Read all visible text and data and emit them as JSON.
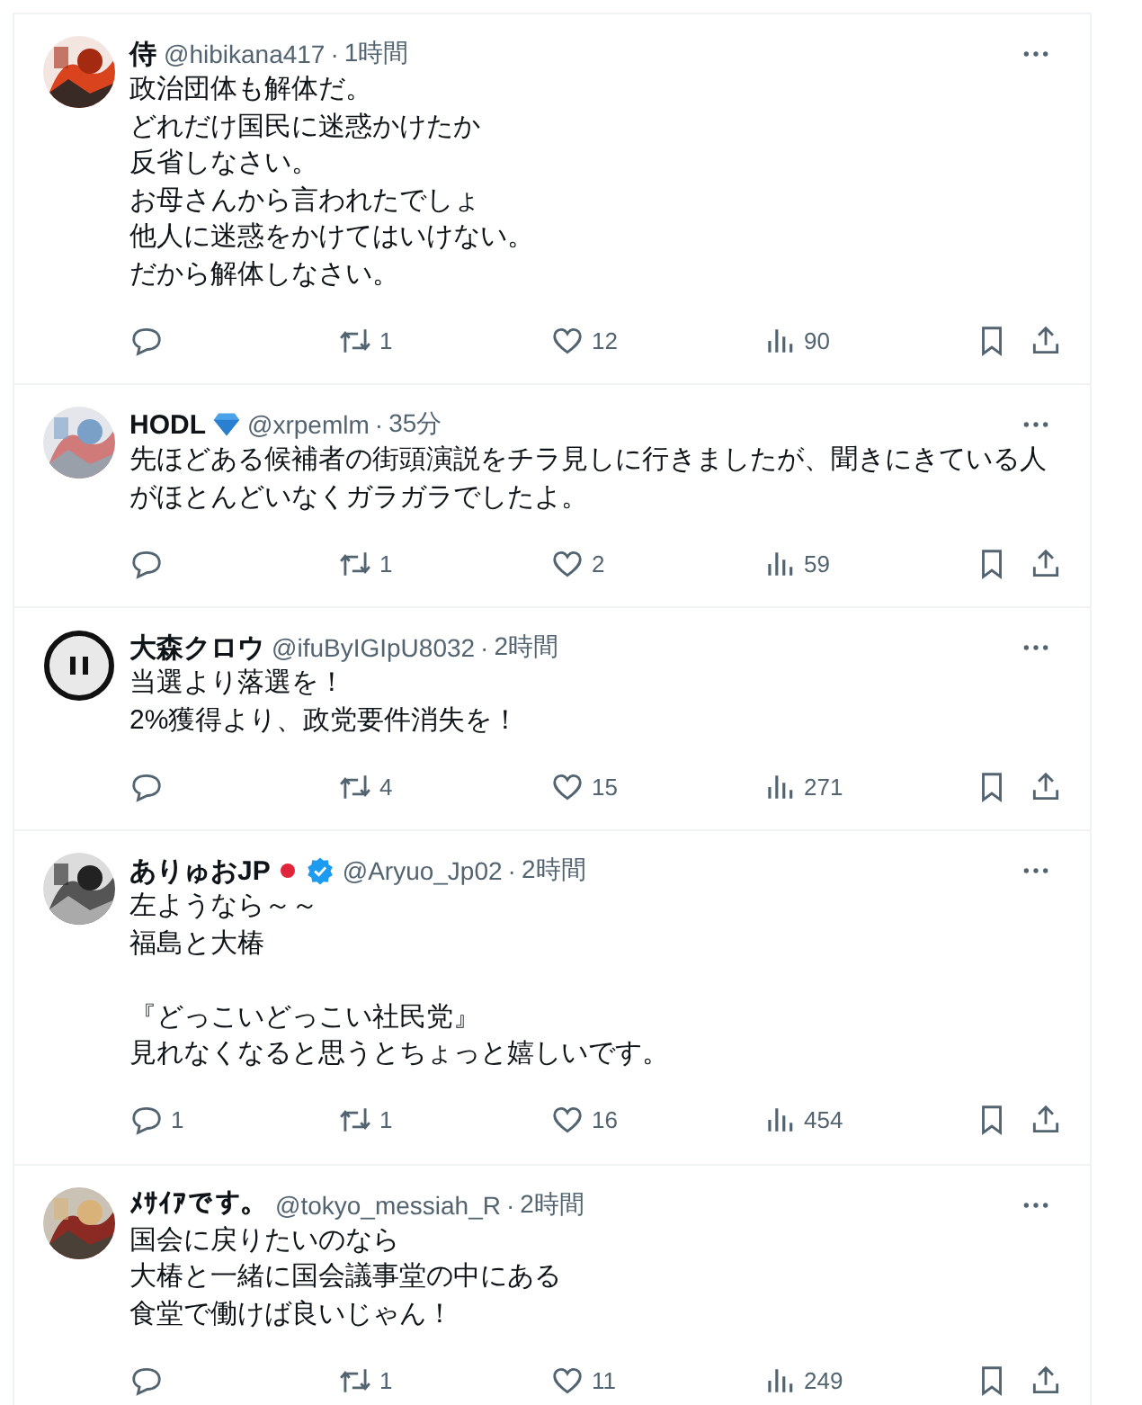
{
  "tweets": [
    {
      "avatar": {
        "kind": "picture"
      },
      "name": "侍",
      "handle": "@hibikana417",
      "separator": "·",
      "time": "1時間",
      "paragraphs": [
        [
          "政治団体も解体だ。",
          "どれだけ国民に迷惑かけたか",
          "反省しなさい。",
          "お母さんから言われたでしょ",
          "他人に迷惑をかけてはいけない。",
          "だから解体しなさい。"
        ]
      ],
      "actions": [
        {
          "kind": "reply"
        },
        {
          "kind": "repost",
          "count": "1"
        },
        {
          "kind": "like",
          "count": "12"
        },
        {
          "kind": "views",
          "count": "90"
        },
        {
          "kind": "bookmark"
        },
        {
          "kind": "share"
        }
      ]
    },
    {
      "avatar": {
        "kind": "picture"
      },
      "name": "HODL",
      "badges": [
        {
          "kind": "diamond"
        }
      ],
      "handle": "@xrpemlm",
      "separator": "·",
      "time": "35分",
      "paragraphs": [
        [
          "先ほどある候補者の街頭演説をチラ見しに行きましたが、聞きにきている人がほとんどいなくガラガラでしたよ。"
        ]
      ],
      "actions": [
        {
          "kind": "reply"
        },
        {
          "kind": "repost",
          "count": "1"
        },
        {
          "kind": "like",
          "count": "2"
        },
        {
          "kind": "views",
          "count": "59"
        },
        {
          "kind": "bookmark"
        },
        {
          "kind": "share"
        }
      ]
    },
    {
      "avatar": {
        "kind": "pause"
      },
      "name": "大森クロウ",
      "handle": "@ifuByIGIpU8032",
      "separator": "·",
      "time": "2時間",
      "paragraphs": [
        [
          "当選より落選を！",
          "2%獲得より、政党要件消失を！"
        ]
      ],
      "actions": [
        {
          "kind": "reply"
        },
        {
          "kind": "repost",
          "count": "4"
        },
        {
          "kind": "like",
          "count": "15"
        },
        {
          "kind": "views",
          "count": "271"
        },
        {
          "kind": "bookmark"
        },
        {
          "kind": "share"
        }
      ]
    },
    {
      "avatar": {
        "kind": "picture"
      },
      "name": "ありゅおJP",
      "badges": [
        {
          "kind": "red-dot"
        },
        {
          "kind": "verified"
        }
      ],
      "handle": "@Aryuo_Jp02",
      "separator": "·",
      "time": "2時間",
      "paragraphs": [
        [
          "左ようなら～～",
          "福島と大椿"
        ],
        [
          "『どっこいどっこい社民党』",
          "見れなくなると思うとちょっと嬉しいです。"
        ]
      ],
      "actions": [
        {
          "kind": "reply",
          "count": "1"
        },
        {
          "kind": "repost",
          "count": "1"
        },
        {
          "kind": "like",
          "count": "16"
        },
        {
          "kind": "views",
          "count": "454"
        },
        {
          "kind": "bookmark"
        },
        {
          "kind": "share"
        }
      ]
    },
    {
      "avatar": {
        "kind": "picture"
      },
      "name": "ﾒｻｲｱです。",
      "handle": "@tokyo_messiah_R",
      "separator": "·",
      "time": "2時間",
      "paragraphs": [
        [
          "国会に戻りたいのなら",
          "大椿と一緒に国会議事堂の中にある",
          "食堂で働けば良いじゃん！"
        ]
      ],
      "actions": [
        {
          "kind": "reply"
        },
        {
          "kind": "repost",
          "count": "1"
        },
        {
          "kind": "like",
          "count": "11"
        },
        {
          "kind": "views",
          "count": "249"
        },
        {
          "kind": "bookmark"
        },
        {
          "kind": "share"
        }
      ]
    }
  ]
}
